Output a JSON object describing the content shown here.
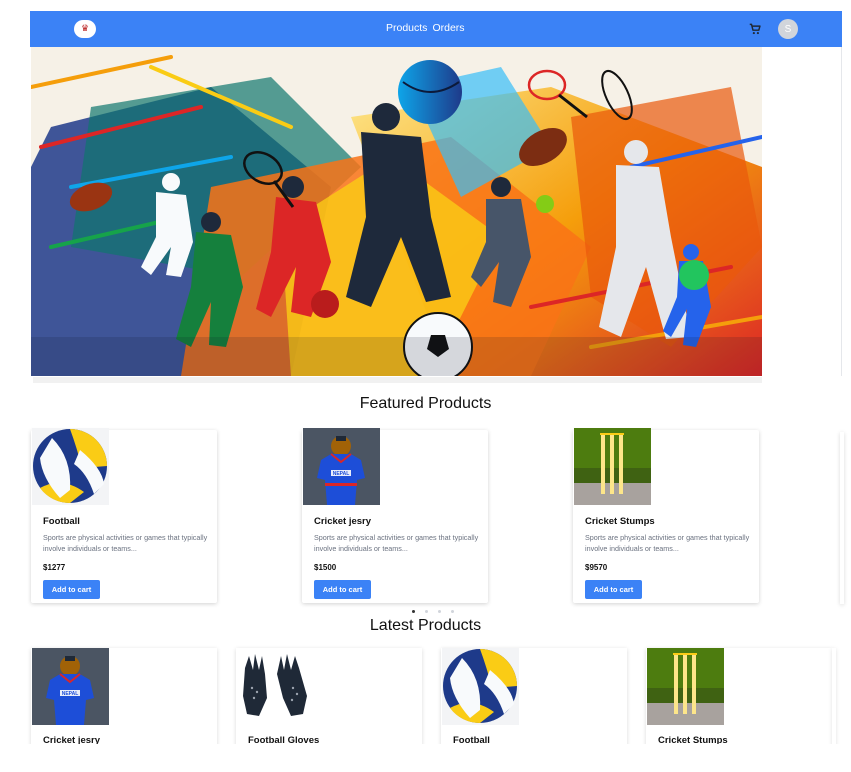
{
  "navbar": {
    "logo_icon": "brand-logo-icon",
    "links": [
      "Products",
      "Orders"
    ],
    "cart_icon": "shopping-cart-icon",
    "avatar_initial": "S",
    "color": "#3b82f6"
  },
  "hero": {
    "image": "sports-collage-banner"
  },
  "featured": {
    "title": "Featured Products",
    "products": [
      {
        "name": "Football",
        "description": "Sports are physical activities or games that typically involve individuals or teams...",
        "price": "$1277",
        "button": "Add to cart",
        "image": "volleyball-ball-image"
      },
      {
        "name": "Cricket jesry",
        "description": "Sports are physical activities or games that typically involve individuals or teams...",
        "price": "$1500",
        "button": "Add to cart",
        "image": "nepal-cricket-jersey-image"
      },
      {
        "name": "Cricket Stumps",
        "description": "Sports are physical activities or games that typically involve individuals or teams...",
        "price": "$9570",
        "button": "Add to cart",
        "image": "cricket-stumps-image"
      }
    ],
    "carousel_pages": 4,
    "active_page": 1
  },
  "latest": {
    "title": "Latest Products",
    "products": [
      {
        "name": "Cricket jesry",
        "image": "nepal-cricket-jersey-image"
      },
      {
        "name": "Football Gloves",
        "image": "football-gloves-image"
      },
      {
        "name": "Football",
        "image": "volleyball-ball-image"
      },
      {
        "name": "Cricket Stumps",
        "image": "cricket-stumps-image"
      }
    ]
  }
}
